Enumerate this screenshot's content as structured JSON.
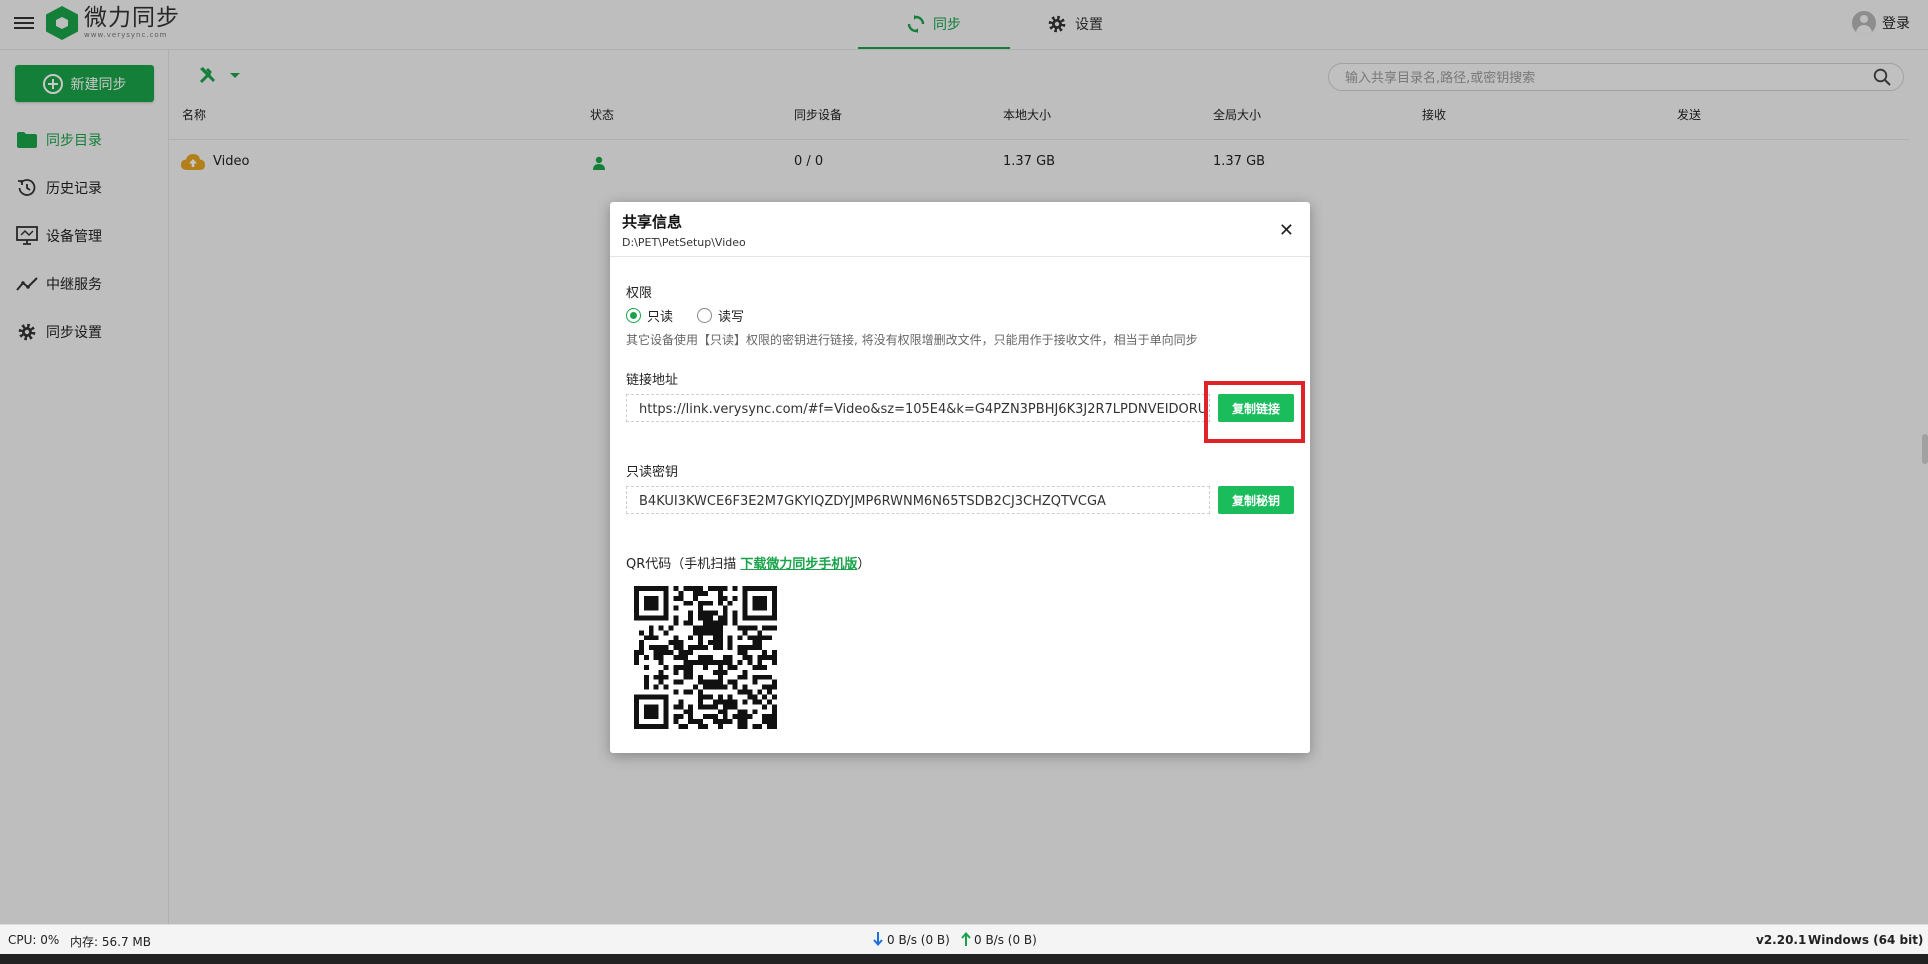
{
  "app": {
    "logo_text": "微力同步",
    "logo_sub": "www.verysync.com"
  },
  "top_tabs": [
    {
      "label": "同步"
    },
    {
      "label": "设置"
    }
  ],
  "login_label": "登录",
  "sidebar": {
    "new_sync": "新建同步",
    "items": [
      {
        "label": "同步目录",
        "icon": "folder-icon"
      },
      {
        "label": "历史记录",
        "icon": "history-icon"
      },
      {
        "label": "设备管理",
        "icon": "device-icon"
      },
      {
        "label": "中继服务",
        "icon": "relay-icon"
      },
      {
        "label": "同步设置",
        "icon": "gear-icon"
      }
    ]
  },
  "search": {
    "placeholder": "输入共享目录名,路径,或密钥搜索"
  },
  "table": {
    "columns": [
      "名称",
      "状态",
      "同步设备",
      "本地大小",
      "全局大小",
      "接收",
      "发送"
    ],
    "rows": [
      {
        "name": "Video",
        "status_icon": "user-icon",
        "devices": "0 / 0",
        "local_size": "1.37 GB",
        "global_size": "1.37 GB",
        "receive": "",
        "send": ""
      }
    ]
  },
  "dialog": {
    "title": "共享信息",
    "path": "D:\\PET\\PetSetup\\Video",
    "permission_label": "权限",
    "radio_readonly": "只读",
    "radio_readwrite": "读写",
    "selected": "只读",
    "hint": "其它设备使用【只读】权限的密钥进行链接, 将没有权限增删改文件，只能用作于接收文件，相当于单向同步",
    "link_label": "链接地址",
    "link_value": "https://link.verysync.com/#f=Video&sz=105E4&k=G4PZN3PBHJ6K3J2R7LPDNVEIDORU",
    "copy_link": "复制链接",
    "key_label": "只读密钥",
    "key_value": "B4KUI3KWCE6F3E2M7GKYIQZDYJMP6RWNM6N65TSDB2CJ3CHZQTVCGA",
    "copy_key": "复制秘钥",
    "qr_label": "QR代码（手机扫描 ",
    "qr_link": "下载微力同步手机版",
    "qr_label_end": "）"
  },
  "statusbar": {
    "cpu": "CPU: 0%",
    "mem": "内存: 56.7 MB",
    "down": "0 B/s (0 B)",
    "up": "0 B/s (0 B)",
    "version": "v2.20.1",
    "os": "Windows (64 bit)"
  },
  "colors": {
    "accent": "#1aa34a",
    "button": "#1abc5c",
    "highlight": "#e0232b"
  }
}
